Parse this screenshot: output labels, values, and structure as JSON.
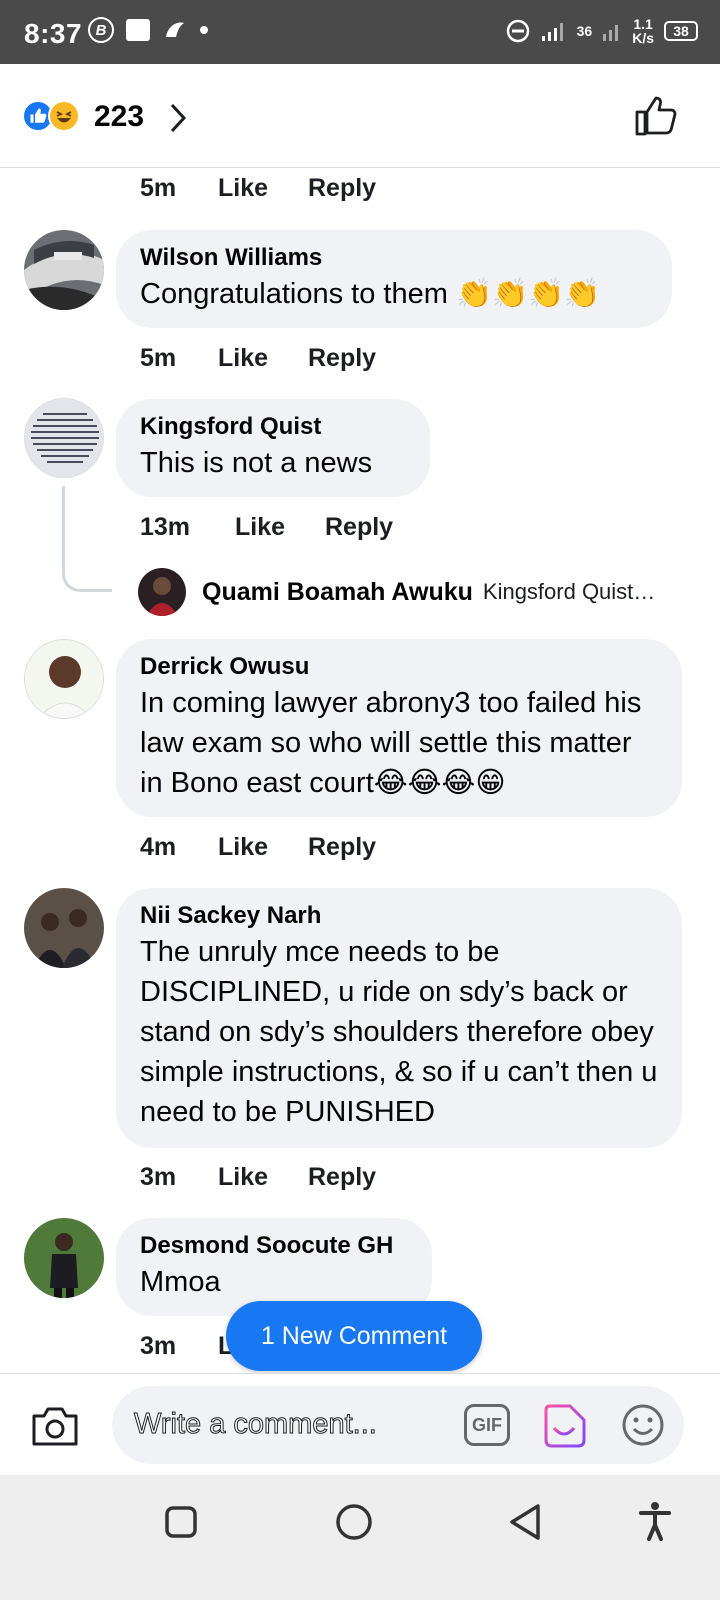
{
  "status_bar": {
    "time": "8:37",
    "network": "36",
    "speed_value": "1.1",
    "speed_unit": "K/s",
    "battery": "38",
    "icons": [
      "b-circle-icon",
      "image-icon",
      "app-notification-icon",
      "dot-icon",
      "do-not-disturb-icon",
      "signal-icon",
      "signal-icon",
      "battery-icon"
    ]
  },
  "header": {
    "reaction_count": "223",
    "icons": [
      "like-reaction-icon",
      "haha-reaction-icon",
      "chevron-right-icon",
      "thumbs-up-outline-icon"
    ]
  },
  "comments": [
    {
      "id": "prev",
      "time": "5m",
      "like_label": "Like",
      "reply_label": "Reply"
    },
    {
      "id": "c1",
      "author": "Wilson Williams",
      "text": "Congratulations to them 👏👏👏👏",
      "time": "5m",
      "like_label": "Like",
      "reply_label": "Reply"
    },
    {
      "id": "c2",
      "author": "Kingsford Quist",
      "text": "This is not a news",
      "time": "13m",
      "like_label": "Like",
      "reply_label": "Reply",
      "reply_preview": {
        "author": "Quami Boamah Awuku",
        "preview": "Kingsford Quist…"
      }
    },
    {
      "id": "c3",
      "author": "Derrick Owusu",
      "text": "In coming lawyer abrony3 too failed his law exam so who will settle this matter in Bono east court😂😂😂😁",
      "time": "4m",
      "like_label": "Like",
      "reply_label": "Reply"
    },
    {
      "id": "c4",
      "author": "Nii Sackey Narh",
      "text": "The unruly mce needs to be DISCIPLINED, u ride on sdy’s back or stand on sdy’s shoulders therefore obey simple instructions, & so if u can’t then u need to be PUNISHED",
      "time": "3m",
      "like_label": "Like",
      "reply_label": "Reply"
    },
    {
      "id": "c5",
      "author": "Desmond Soocute GH",
      "text": "Mmoa",
      "time": "3m",
      "like_label": "L"
    }
  ],
  "new_comment_pill": "1 New Comment",
  "composer": {
    "placeholder": "Write a comment...",
    "gif_label": "GIF",
    "icons": [
      "camera-icon",
      "gif-icon",
      "sticker-icon",
      "emoji-icon"
    ]
  },
  "nav_bar": {
    "icons": [
      "recents-square-icon",
      "home-circle-icon",
      "back-triangle-icon",
      "accessibility-icon"
    ]
  },
  "colors": {
    "accent": "#1877f2",
    "bubble": "#f0f2f5",
    "status_bar": "#4a4a4a",
    "nav_bar": "#eeeeee"
  }
}
